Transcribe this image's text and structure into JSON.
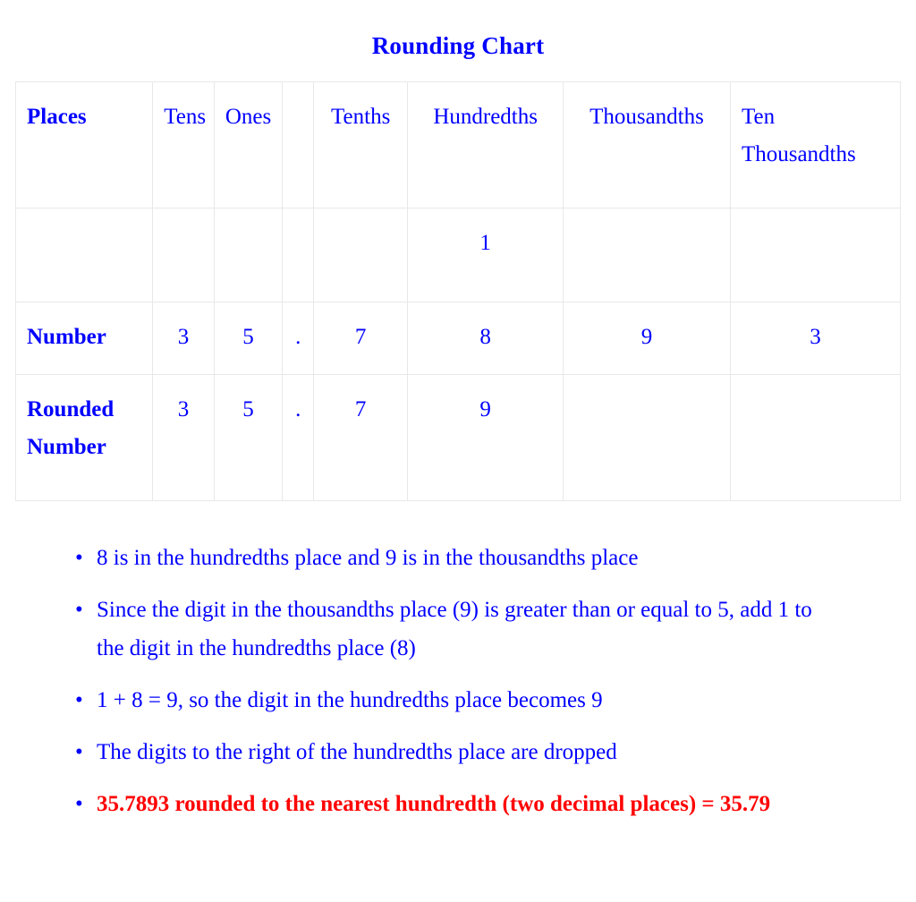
{
  "title": "Rounding Chart",
  "colors": {
    "primary_blue": "#0000FF",
    "accent_red": "#FF0000",
    "table_border": "#E8E8E8",
    "background": "#FFFFFF"
  },
  "table": {
    "columns": [
      {
        "key": "label",
        "header": "Places"
      },
      {
        "key": "tens",
        "header": "Tens"
      },
      {
        "key": "ones",
        "header": "Ones"
      },
      {
        "key": "point",
        "header": ""
      },
      {
        "key": "tenths",
        "header": "Tenths"
      },
      {
        "key": "hundredths",
        "header": "Hundredths"
      },
      {
        "key": "thousandths",
        "header": "Thousandths"
      },
      {
        "key": "tenthousandths",
        "header": "Ten Thousandths"
      }
    ],
    "rows": [
      {
        "name": "carry-row",
        "label": "",
        "color": "#0000FF",
        "cells": [
          "",
          "",
          "",
          "",
          "",
          "1",
          "",
          ""
        ]
      },
      {
        "name": "number-row",
        "label": "Number",
        "color": "#0000FF",
        "cells": [
          "",
          "3",
          "5",
          ".",
          "7",
          "8",
          "9",
          "3"
        ]
      },
      {
        "name": "rounded-row",
        "label": "Rounded Number",
        "color": "#FF0000",
        "cells": [
          "",
          "3",
          "5",
          ".",
          "7",
          "9",
          "",
          ""
        ]
      }
    ]
  },
  "notes": [
    {
      "text": "8 is in the hundredths place and 9 is in the thousandths place",
      "emphasis": false
    },
    {
      "text": "Since the digit in the thousandths place (9) is greater than or equal to 5, add 1 to the digit in the hundredths place (8)",
      "emphasis": false
    },
    {
      "text": "1 + 8 = 9, so the digit in the hundredths place becomes 9",
      "emphasis": false
    },
    {
      "text": "The digits to the right of the hundredths place are dropped",
      "emphasis": false
    },
    {
      "text": "35.7893 rounded to the nearest hundredth (two decimal places) = 35.79",
      "emphasis": true
    }
  ]
}
